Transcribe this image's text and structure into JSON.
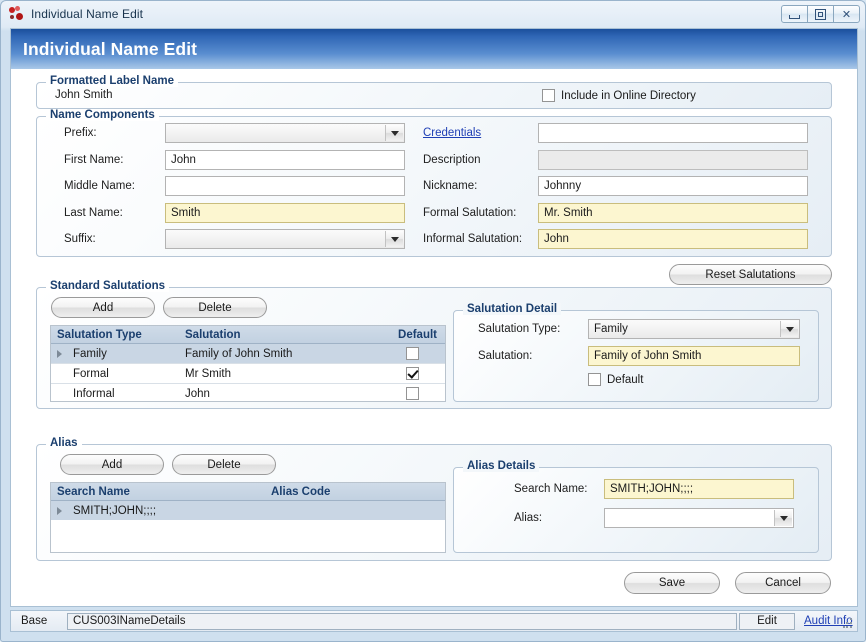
{
  "window": {
    "title": "Individual Name Edit",
    "icon": "app-icon",
    "buttons": {
      "minimize": "minimize-icon",
      "maximize": "maximize-icon",
      "close": "close-icon"
    }
  },
  "banner": {
    "title": "Individual Name Edit"
  },
  "formatted_label_name": {
    "group_title": "Formatted Label Name",
    "value": "John Smith",
    "include_in_online_directory": {
      "label": "Include in Online Directory",
      "checked": false
    }
  },
  "name_components": {
    "group_title": "Name Components",
    "left": {
      "prefix": {
        "label": "Prefix:",
        "value": "",
        "type": "combo"
      },
      "first_name": {
        "label": "First Name:",
        "value": "John",
        "type": "text"
      },
      "middle_name": {
        "label": "Middle Name:",
        "value": "",
        "type": "text"
      },
      "last_name": {
        "label": "Last Name:",
        "value": "Smith",
        "type": "text",
        "required": true
      },
      "suffix": {
        "label": "Suffix:",
        "value": "",
        "type": "combo"
      }
    },
    "right": {
      "credentials": {
        "label": "Credentials",
        "value": "",
        "type": "text",
        "is_link": true
      },
      "description": {
        "label": "Description",
        "value": "",
        "type": "text",
        "readonly": true
      },
      "nickname": {
        "label": "Nickname:",
        "value": "Johnny",
        "type": "text"
      },
      "formal_salutation": {
        "label": "Formal Salutation:",
        "value": "Mr. Smith",
        "type": "text",
        "required": true
      },
      "informal_salutation": {
        "label": "Informal Salutation:",
        "value": "John",
        "type": "text",
        "required": true
      }
    }
  },
  "reset_salutations_button": "Reset Salutations",
  "standard_salutations": {
    "group_title": "Standard Salutations",
    "add_button": "Add",
    "delete_button": "Delete",
    "grid": {
      "columns": [
        "Salutation Type",
        "Salutation",
        "Default"
      ],
      "rows": [
        {
          "type": "Family",
          "salutation": "Family of John Smith",
          "default": false,
          "selected": true
        },
        {
          "type": "Formal",
          "salutation": "Mr Smith",
          "default": true,
          "selected": false
        },
        {
          "type": "Informal",
          "salutation": "John",
          "default": false,
          "selected": false
        }
      ]
    }
  },
  "salutation_detail": {
    "group_title": "Salutation Detail",
    "salutation_type": {
      "label": "Salutation Type:",
      "value": "Family"
    },
    "salutation": {
      "label": "Salutation:",
      "value": "Family of John Smith",
      "required": true
    },
    "default": {
      "label": "Default",
      "checked": false
    }
  },
  "alias": {
    "group_title": "Alias",
    "add_button": "Add",
    "delete_button": "Delete",
    "grid": {
      "columns": [
        "Search Name",
        "Alias Code"
      ],
      "rows": [
        {
          "search_name": "SMITH;JOHN;;;;",
          "alias_code": "",
          "selected": true
        }
      ]
    }
  },
  "alias_details": {
    "group_title": "Alias Details",
    "search_name": {
      "label": "Search Name:",
      "value": "SMITH;JOHN;;;;",
      "required": true
    },
    "alias": {
      "label": "Alias:",
      "value": ""
    }
  },
  "footer": {
    "save_button": "Save",
    "cancel_button": "Cancel"
  },
  "statusbar": {
    "base_label": "Base",
    "base_value": "CUS003INameDetails",
    "mode": "Edit",
    "audit_link": "Audit Info"
  },
  "colors": {
    "banner_top": "#1b4f9c",
    "banner_bottom": "#a9c8e8",
    "group_title": "#1b3f6e",
    "required_field": "#fcf6d0",
    "link": "#1f3fb5",
    "grid_header": "#c2d1e1",
    "row_selected": "#c9d6e4"
  }
}
